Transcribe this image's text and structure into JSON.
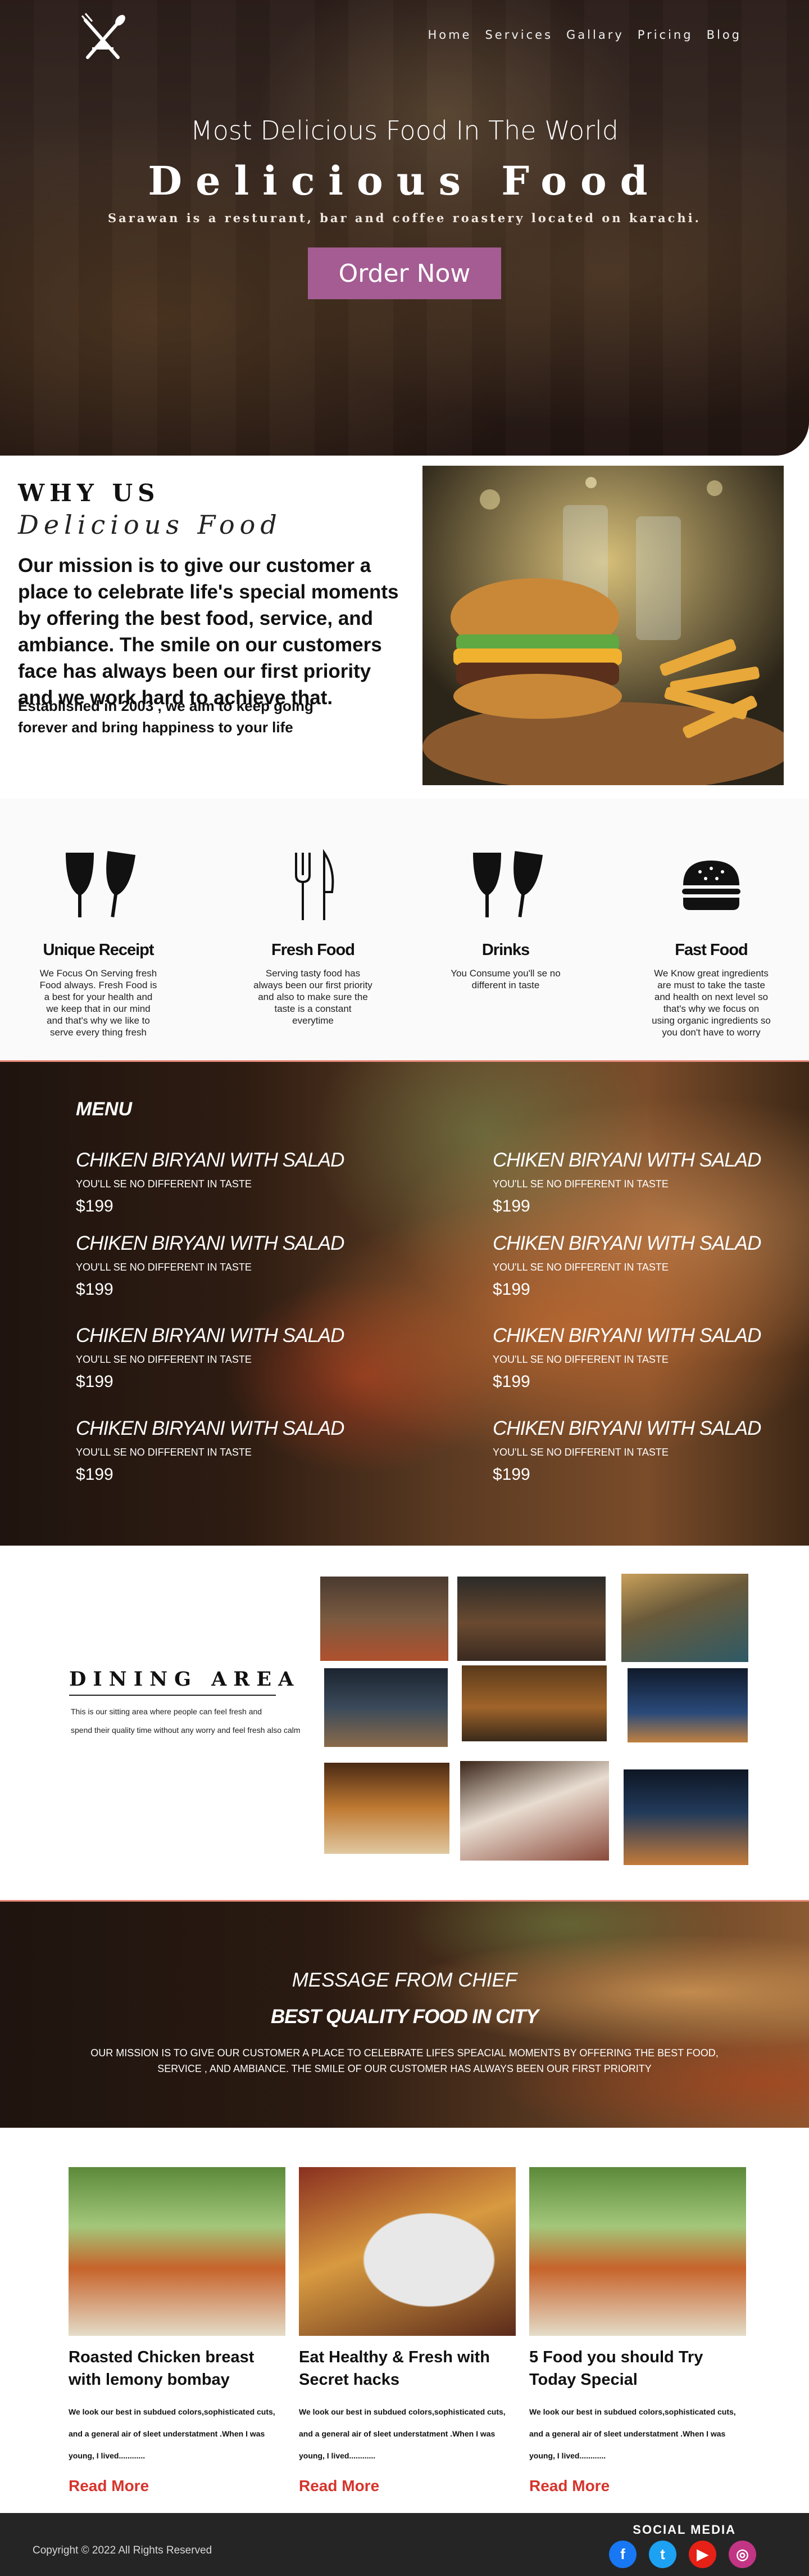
{
  "nav": {
    "items": [
      "Home",
      "Services",
      "Gallary",
      "Pricing",
      "Blog"
    ]
  },
  "hero": {
    "subtitle": "Most Delicious Food  In The World",
    "title": "Delicious Food",
    "tagline": "Sarawan is a resturant, bar and coffee roastery located on karachi.",
    "cta_label": "Order Now"
  },
  "why": {
    "heading": "WHY US",
    "subheading": "Delicious Food",
    "mission": "Our mission is to give our customer a place to celebrate life's special moments by offering the best food, service, and ambiance. The smile on our customers face has always been our first priority and we work hard to achieve that.",
    "established": "Established in 2003 , we aim to keep going forever and bring happiness to your life"
  },
  "features": [
    {
      "icon": "wine-glasses-icon",
      "title": "Unique Receipt",
      "desc": "We Focus On Serving fresh Food always. Fresh Food is a best for your health and we keep that in our mind and that's why we like to serve every thing fresh"
    },
    {
      "icon": "fork-knife-icon",
      "title": "Fresh Food",
      "desc": "Serving tasty food has always been our first priority and also to make sure the taste is a constant everytime"
    },
    {
      "icon": "wine-glasses-icon",
      "title": "Drinks",
      "desc": "You Consume you'll se no different in taste"
    },
    {
      "icon": "burger-icon",
      "title": "Fast Food",
      "desc": "We Know great ingredients are must to take the taste and health on next level so that's why we focus on using organic ingredients so you don't have to worry"
    }
  ],
  "menu": {
    "title": "MENU",
    "items": [
      {
        "name": "CHIKEN BIRYANI  WITH SALAD",
        "desc": "YOU'LL SE NO DIFFERENT IN TASTE",
        "price": "$199"
      },
      {
        "name": "CHIKEN BIRYANI  WITH SALAD",
        "desc": "YOU'LL SE NO DIFFERENT IN TASTE",
        "price": "$199"
      },
      {
        "name": "CHIKEN BIRYANI  WITH SALAD",
        "desc": "YOU'LL SE NO DIFFERENT IN TASTE",
        "price": "$199"
      },
      {
        "name": "CHIKEN BIRYANI  WITH SALAD",
        "desc": "YOU'LL SE NO DIFFERENT IN TASTE",
        "price": "$199"
      },
      {
        "name": "CHIKEN BIRYANI  WITH SALAD",
        "desc": "YOU'LL SE NO DIFFERENT IN TASTE",
        "price": "$199"
      },
      {
        "name": "CHIKEN BIRYANI  WITH SALAD",
        "desc": "YOU'LL SE NO DIFFERENT IN TASTE",
        "price": "$199"
      },
      {
        "name": "CHIKEN BIRYANI  WITH SALAD",
        "desc": "YOU'LL SE NO DIFFERENT IN TASTE",
        "price": "$199"
      },
      {
        "name": "CHIKEN BIRYANI  WITH SALAD",
        "desc": "YOU'LL SE NO DIFFERENT IN TASTE",
        "price": "$199"
      }
    ]
  },
  "dining": {
    "heading": "DINING AREA",
    "line1": "This is  our sitting area where people can feel fresh and",
    "line2": "spend their quality time without any worry and feel fresh also calm"
  },
  "chief": {
    "title": "MESSAGE FROM CHIEF",
    "subtitle": "BEST QUALITY  FOOD IN CITY",
    "text": "OUR MISSION IS TO GIVE OUR CUSTOMER A PLACE TO CELEBRATE LIFES SPEACIAL MOMENTS BY OFFERING THE BEST FOOD, SERVICE , AND AMBIANCE. THE SMILE OF OUR CUSTOMER HAS ALWAYS BEEN OUR FIRST PRIORITY"
  },
  "blog": [
    {
      "title": "Roasted Chicken breast with lemony bombay",
      "desc": "We look our best in subdued colors,sophisticated cuts, and a general air of sleet understatment .When I was young, I lived............",
      "link": "Read More"
    },
    {
      "title": "Eat Healthy & Fresh with Secret hacks",
      "desc": "We look our best in subdued colors,sophisticated cuts, and a general air of sleet understatment .When I was young, I lived............",
      "link": "Read More"
    },
    {
      "title": "5 Food you should Try Today Special",
      "desc": "We look our best in subdued colors,sophisticated cuts, and a general air of sleet understatment .When I was young, I lived............",
      "link": "Read More"
    }
  ],
  "footer": {
    "copyright": "Copyright © 2022 All Rights Reserved",
    "social_title": "SOCIAL MEDIA",
    "social": [
      {
        "name": "facebook-icon",
        "glyph": "f",
        "color": "#1877f2"
      },
      {
        "name": "twitter-icon",
        "glyph": "t",
        "color": "#1da1f2"
      },
      {
        "name": "youtube-icon",
        "glyph": "▶",
        "color": "#e62117"
      },
      {
        "name": "instagram-icon",
        "glyph": "◎",
        "color": "#c13584"
      }
    ]
  },
  "colors": {
    "accent": "#a45c92",
    "read_more": "#d6342c",
    "divider": "#e88a7a",
    "footer_bg": "#252525"
  }
}
